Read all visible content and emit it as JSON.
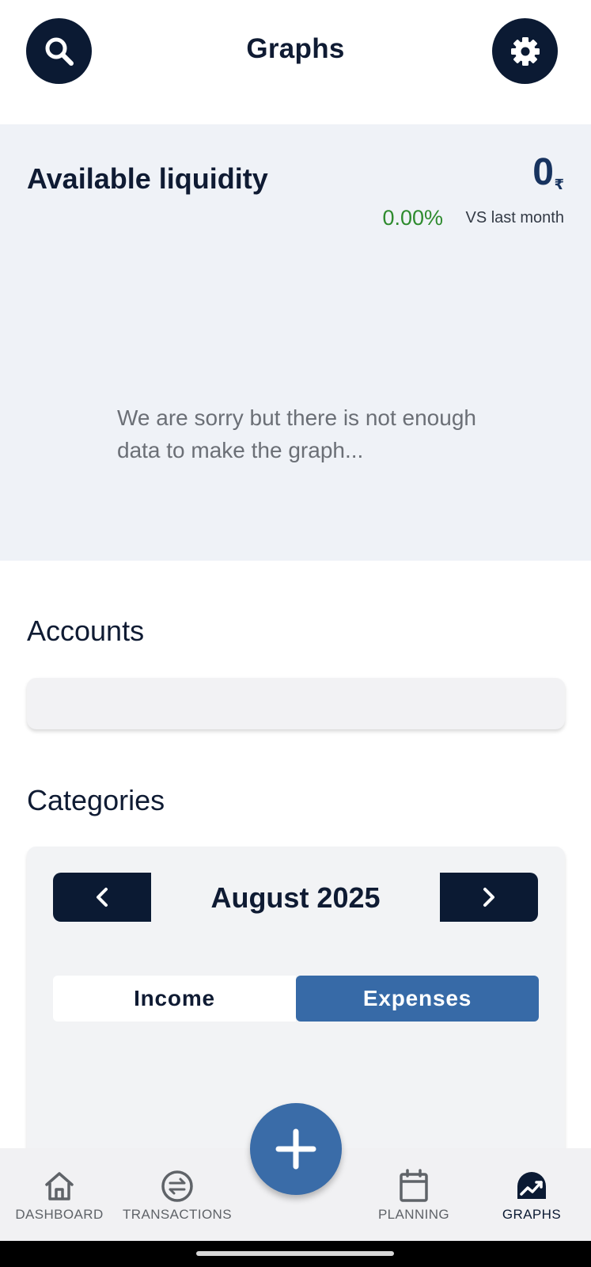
{
  "header": {
    "title": "Graphs",
    "search_icon": "search-icon",
    "settings_icon": "gear-icon"
  },
  "liquidity": {
    "title": "Available liquidity",
    "amount": "0",
    "currency": "₹",
    "change": "0.00%",
    "vs_label": "VS last month",
    "empty_message": "We are sorry but there is not enough data to make the graph..."
  },
  "accounts": {
    "title": "Accounts"
  },
  "categories": {
    "title": "Categories",
    "month": "August 2025",
    "prev_icon": "chevron-left-icon",
    "next_icon": "chevron-right-icon",
    "toggle": {
      "income": "Income",
      "expenses": "Expenses",
      "selected": "Expenses"
    }
  },
  "nav": {
    "items": [
      {
        "label": "DASHBOARD",
        "icon": "home-icon"
      },
      {
        "label": "TRANSACTIONS",
        "icon": "swap-icon"
      },
      {
        "label": "PLANNING",
        "icon": "calendar-icon"
      },
      {
        "label": "GRAPHS",
        "icon": "trending-chart-icon",
        "active": true
      }
    ],
    "fab_icon": "plus-icon"
  },
  "colors": {
    "primary_dark": "#0b1a33",
    "accent_blue": "#3a6ca8",
    "positive_green": "#2e8b2e",
    "panel_bg": "#eff2f7"
  }
}
